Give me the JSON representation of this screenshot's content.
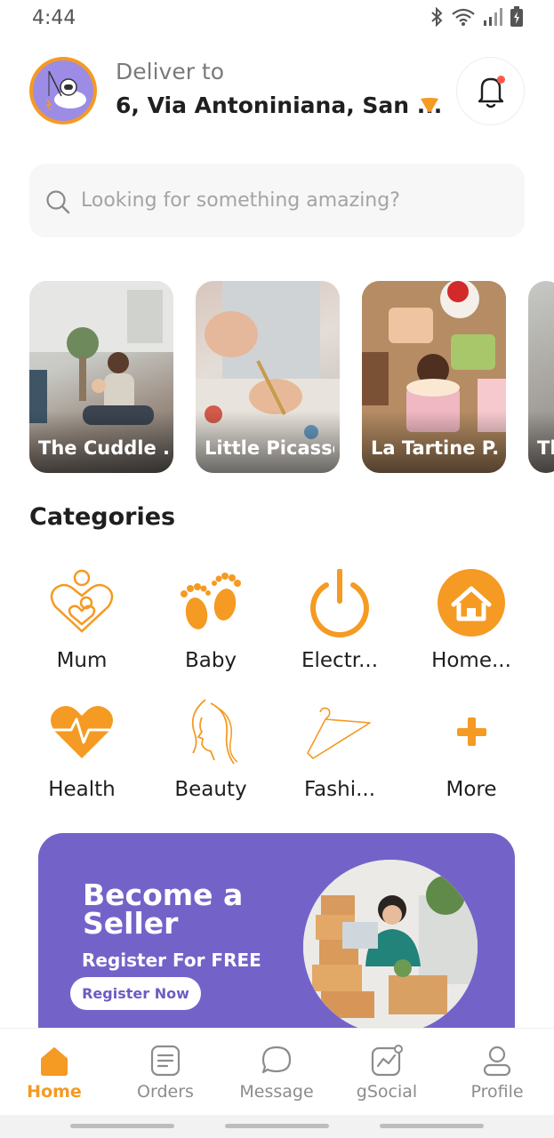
{
  "status_bar": {
    "time": "4:44"
  },
  "header": {
    "deliver_label": "Deliver to",
    "address": "6, Via Antoniniana, San ...",
    "accent": "#f59a23"
  },
  "search": {
    "placeholder": "Looking for something amazing?"
  },
  "stories": [
    {
      "label": "The Cuddle ..."
    },
    {
      "label": "Little Picassos"
    },
    {
      "label": "La Tartine P..."
    },
    {
      "label": "Th"
    }
  ],
  "categories": {
    "title": "Categories",
    "items": [
      {
        "label": "Mum",
        "icon": "mother-child-heart-icon"
      },
      {
        "label": "Baby",
        "icon": "baby-feet-icon"
      },
      {
        "label": "Electr...",
        "icon": "power-icon"
      },
      {
        "label": "Home...",
        "icon": "home-icon"
      },
      {
        "label": "Health",
        "icon": "heartbeat-icon"
      },
      {
        "label": "Beauty",
        "icon": "woman-face-icon"
      },
      {
        "label": "Fashi...",
        "icon": "hanger-icon"
      },
      {
        "label": "More",
        "icon": "plus-icon"
      }
    ]
  },
  "banner": {
    "headline_1": "Become a",
    "headline_2": "Seller",
    "subtitle": "Register For FREE",
    "button": "Register Now",
    "background": "#7363c9"
  },
  "bottom_nav": {
    "items": [
      {
        "label": "Home",
        "icon": "home-icon",
        "active": true
      },
      {
        "label": "Orders",
        "icon": "orders-icon"
      },
      {
        "label": "Message",
        "icon": "chat-icon"
      },
      {
        "label": "gSocial",
        "icon": "social-chart-icon"
      },
      {
        "label": "Profile",
        "icon": "profile-icon"
      }
    ]
  }
}
